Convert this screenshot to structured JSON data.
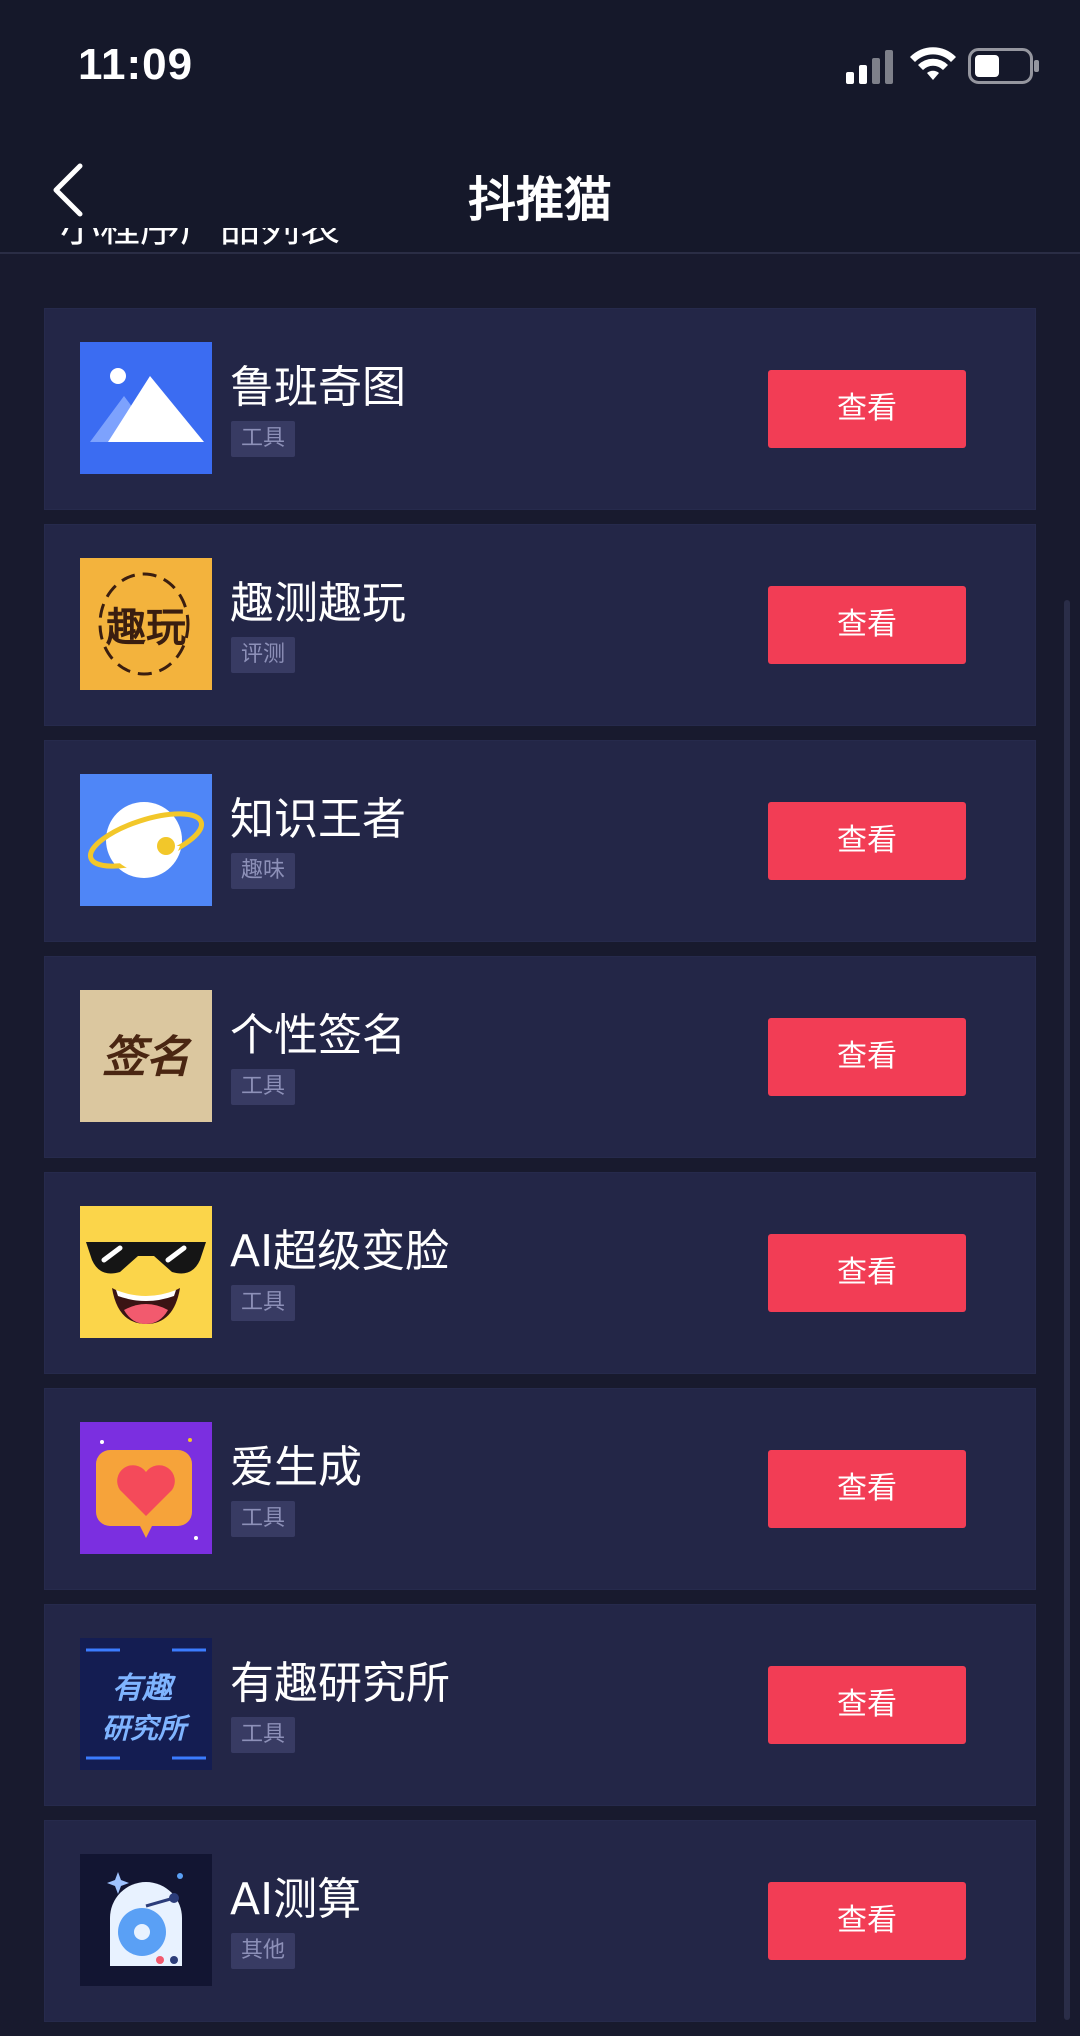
{
  "status": {
    "time": "11:09"
  },
  "header": {
    "title": "抖推猫",
    "peek_text": "小程序产品列表"
  },
  "items": [
    {
      "name": "鲁班奇图",
      "tag": "工具",
      "button": "查看",
      "icon": "mountain-image-icon"
    },
    {
      "name": "趣测趣玩",
      "tag": "评测",
      "button": "查看",
      "icon": "quce-quwan-logo-icon",
      "icon_text": "趣玩"
    },
    {
      "name": "知识王者",
      "tag": "趣味",
      "button": "查看",
      "icon": "planet-orbit-icon"
    },
    {
      "name": "个性签名",
      "tag": "工具",
      "button": "查看",
      "icon": "signature-logo-icon",
      "icon_text": "签名"
    },
    {
      "name": "AI超级变脸",
      "tag": "工具",
      "button": "查看",
      "icon": "sunglasses-face-icon"
    },
    {
      "name": "爱生成",
      "tag": "工具",
      "button": "查看",
      "icon": "heart-chat-icon"
    },
    {
      "name": "有趣研究所",
      "tag": "工具",
      "button": "查看",
      "icon": "youqu-yanjiusuo-logo-icon",
      "icon_text_1": "有趣",
      "icon_text_2": "研究所"
    },
    {
      "name": "AI测算",
      "tag": "其他",
      "button": "查看",
      "icon": "crystal-disc-icon"
    }
  ],
  "colors": {
    "accent": "#f23d55",
    "card": "#232647",
    "background": "#181a2e",
    "tag_bg": "#383b63"
  }
}
